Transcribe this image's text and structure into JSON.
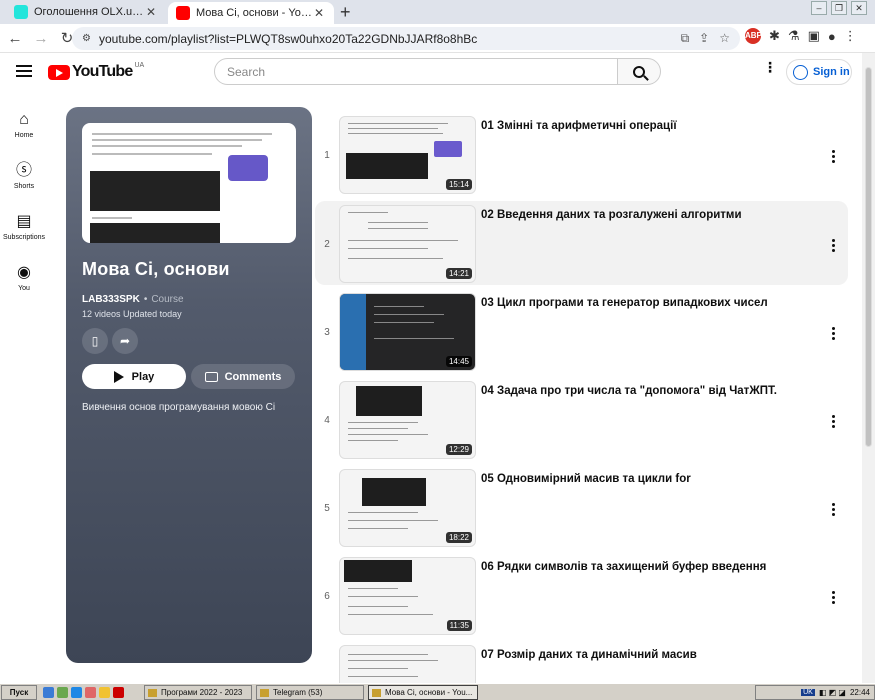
{
  "browser": {
    "tabs": [
      {
        "title": "Оголошення OLX.ua: сервіс оголо",
        "favicon_color": "#23e5db"
      },
      {
        "title": "Мова Сі, основи - YouTube",
        "favicon_color": "#ff0000"
      }
    ],
    "url": "youtube.com/playlist?list=PLWQT8sw0uhxo20Ta22GDNbJJARf8o8hBc",
    "extension_badge": "ABP"
  },
  "youtube": {
    "logo_text": "YouTube",
    "region": "UA",
    "search_placeholder": "Search",
    "sign_in": "Sign in",
    "guide": [
      {
        "label": "Home",
        "icon": "home-icon"
      },
      {
        "label": "Shorts",
        "icon": "shorts-icon"
      },
      {
        "label": "Subscriptions",
        "icon": "subscriptions-icon"
      },
      {
        "label": "You",
        "icon": "you-icon"
      }
    ]
  },
  "playlist": {
    "title": "Мова Сі, основи",
    "owner": "LAB333SPK",
    "kind": "Course",
    "video_count": "12 videos",
    "updated": "Updated today",
    "play_label": "Play",
    "comments_label": "Comments",
    "description": "Вивчення основ програмування мовою Сі"
  },
  "videos": [
    {
      "index": "1",
      "title": "01 Змінні та арифметичні операції",
      "duration": "15:14"
    },
    {
      "index": "2",
      "title": "02 Введення даних та розгалужені алгоритми",
      "duration": "14:21"
    },
    {
      "index": "3",
      "title": "03 Цикл програми та генератор випадкових чисел",
      "duration": "14:45"
    },
    {
      "index": "4",
      "title": "04 Задача про три числа та \"допомога\" від ЧатЖПТ.",
      "duration": "12:29"
    },
    {
      "index": "5",
      "title": "05 Одновимірний масив та цикли for",
      "duration": "18:22"
    },
    {
      "index": "6",
      "title": "06 Рядки символів та захищений буфер введення",
      "duration": "11:35"
    },
    {
      "index": "7",
      "title": "07 Розмір даних та динамічний масив",
      "duration": ""
    }
  ],
  "taskbar": {
    "start": "Пуск",
    "tasks": [
      "Програми 2022 - 2023",
      "Telegram (53)",
      "Мова Сі, основи - You..."
    ],
    "lang": "UK",
    "clock": "22:44"
  }
}
